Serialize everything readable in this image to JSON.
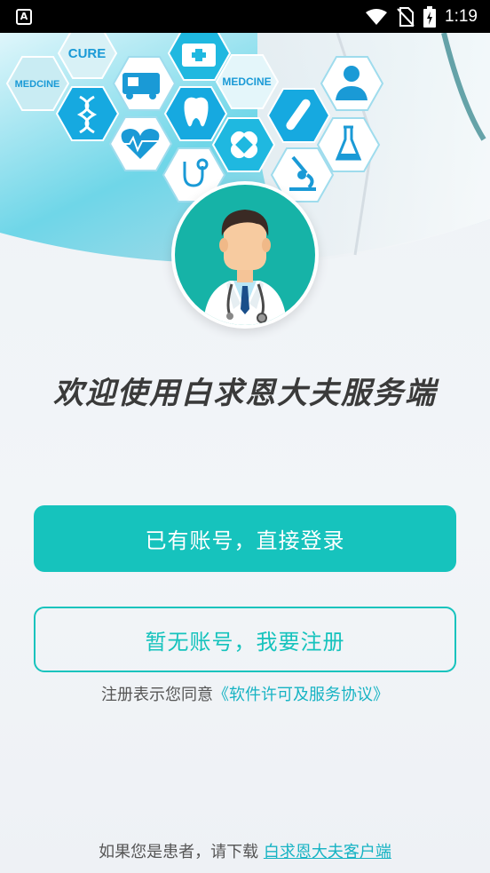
{
  "status_bar": {
    "app_icon_letter": "A",
    "time": "1:19"
  },
  "header": {
    "badges": {
      "cure": "CURE",
      "medcine_left": "MEDCINE",
      "medcine_right": "MEDCINE"
    }
  },
  "welcome": {
    "title": "欢迎使用白求恩大夫服务端"
  },
  "actions": {
    "login_label": "已有账号，直接登录",
    "register_label": "暂无账号，我要注册"
  },
  "agreement": {
    "prefix": "注册表示您同意",
    "link_text": "《软件许可及服务协议》"
  },
  "footer": {
    "prefix": "如果您是患者，请下载 ",
    "link_text": "白求恩大夫客户端"
  },
  "colors": {
    "accent": "#16c3bd",
    "banner_cyan": "#1fb8e0",
    "title_text": "#3a3a3a"
  }
}
